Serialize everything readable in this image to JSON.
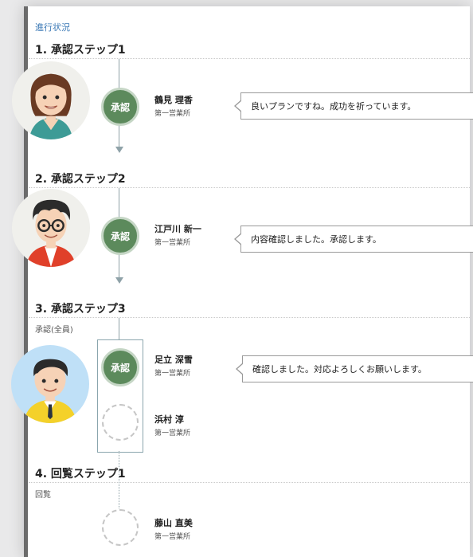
{
  "header": {
    "section_title": "進行状況"
  },
  "steps": [
    {
      "title": "1. 承認ステップ1",
      "subtitle": ""
    },
    {
      "title": "2. 承認ステップ2",
      "subtitle": ""
    },
    {
      "title": "3. 承認ステップ3",
      "subtitle": "承認(全員)"
    },
    {
      "title": "4. 回覧ステップ1",
      "subtitle": "回覧"
    }
  ],
  "badge_label": "承認",
  "people": [
    {
      "name": "鶴見 理香",
      "org": "第一営業所",
      "comment": "良いプランですね。成功を祈っています。",
      "status": "approved"
    },
    {
      "name": "江戸川 新一",
      "org": "第一営業所",
      "comment": "内容確認しました。承認します。",
      "status": "approved"
    },
    {
      "name": "足立 深雪",
      "org": "第一営業所",
      "comment": "確認しました。対応よろしくお願いします。",
      "status": "approved"
    },
    {
      "name": "浜村 淳",
      "org": "第一営業所",
      "comment": "",
      "status": "pending"
    },
    {
      "name": "藤山 直美",
      "org": "第一営業所",
      "comment": "",
      "status": "pending"
    }
  ],
  "colors": {
    "accent": "#3a78b5",
    "approved": "#5c8a5c",
    "connector": "#8fa2a8"
  },
  "icons": [
    "avatar-woman-icon",
    "avatar-man-glasses-icon",
    "avatar-man-yellow-icon"
  ]
}
